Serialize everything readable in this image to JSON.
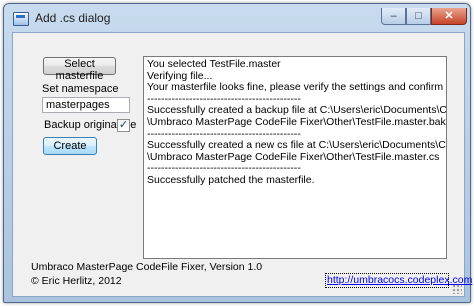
{
  "window": {
    "title": "Add .cs dialog",
    "controls": {
      "minimize": "‒",
      "maximize": "□",
      "close": "✕"
    }
  },
  "form": {
    "select_masterfile_label": "Select masterfile",
    "namespace_label": "Set namespace",
    "namespace_value": "masterpages",
    "backup_label": "Backup original file",
    "backup_checked": true,
    "backup_check_glyph": "✓",
    "create_label": "Create"
  },
  "log": {
    "lines": [
      "You selected TestFile.master",
      "Verifying file...",
      "Your masterfile looks fine, please verify the settings and confirm",
      "--------------------------------------------",
      "Successfully created a backup file at C:\\Users\\eric\\Documents\\Codeplex",
      "\\Umbraco MasterPage CodeFile Fixer\\Other\\TestFile.master.bak",
      "--------------------------------------------",
      "Successfully created a new cs file at C:\\Users\\eric\\Documents\\Codeplex",
      "\\Umbraco MasterPage CodeFile Fixer\\Other\\TestFile.master.cs",
      "--------------------------------------------",
      "Successfully patched the masterfile."
    ]
  },
  "footer": {
    "version": "Umbraco MasterPage CodeFile Fixer, Version 1.0",
    "copyright": "© Eric Herlitz, 2012",
    "link": "http://umbracocs.codeplex.com"
  },
  "colors": {
    "client_background": "#f0f0f0",
    "link": "#0000ee",
    "close_button": "#c7442b"
  }
}
